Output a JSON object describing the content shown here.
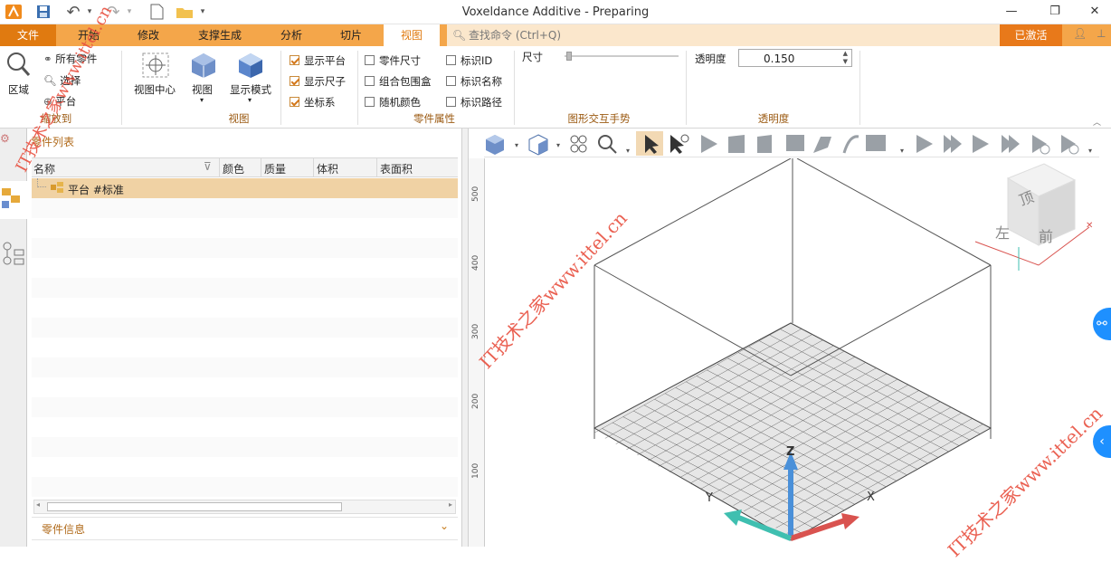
{
  "app": {
    "title": "Voxeldance Additive - Preparing"
  },
  "menu": {
    "file": "文件",
    "start": "开始",
    "modify": "修改",
    "support": "支撑生成",
    "analysis": "分析",
    "slice": "切片",
    "view": "视图",
    "search_placeholder": "查找命令 (Ctrl+Q)",
    "activated": "已激活"
  },
  "ribbon": {
    "zoom_to": {
      "area": "区域",
      "all_parts": "所有零件",
      "select": "选择",
      "platform": "平台",
      "group": "缩放到"
    },
    "view": {
      "view_center": "视图中心",
      "view": "视图",
      "display_mode": "显示模式",
      "group": "视图"
    },
    "checks": {
      "show_platform": "显示平台",
      "show_ruler": "显示尺子",
      "coordinate": "坐标系",
      "part_size": "零件尺寸",
      "group_bbox": "组合包围盒",
      "random_color": "随机颜色",
      "label_id": "标识ID",
      "label_name": "标识名称",
      "label_path": "标识路径",
      "group": "零件属性"
    },
    "gesture": {
      "size_label": "尺寸",
      "group": "图形交互手势"
    },
    "transparency": {
      "label": "透明度",
      "value": "0.150",
      "group": "透明度"
    }
  },
  "panel": {
    "title": "零件列表",
    "columns": [
      "名称",
      "颜色",
      "质量",
      "体积",
      "表面积"
    ],
    "rows": [
      {
        "name": "平台 #标准"
      }
    ],
    "part_info": "零件信息"
  },
  "viewport": {
    "ruler_ticks": [
      "500",
      "400",
      "300",
      "200",
      "100"
    ],
    "axes": {
      "x": "X",
      "y": "Y",
      "z": "Z"
    },
    "cube_faces": {
      "top": "顶",
      "left": "左",
      "front": "前"
    }
  },
  "watermark": "IT技术之家www.ittel.cn",
  "colors": {
    "accent": "#e07a10",
    "menubar": "#f4a64a",
    "selected_row": "#f0d2a4",
    "axis_x": "#d9534f",
    "axis_y": "#3fbfb0",
    "axis_z": "#4a90d9"
  }
}
